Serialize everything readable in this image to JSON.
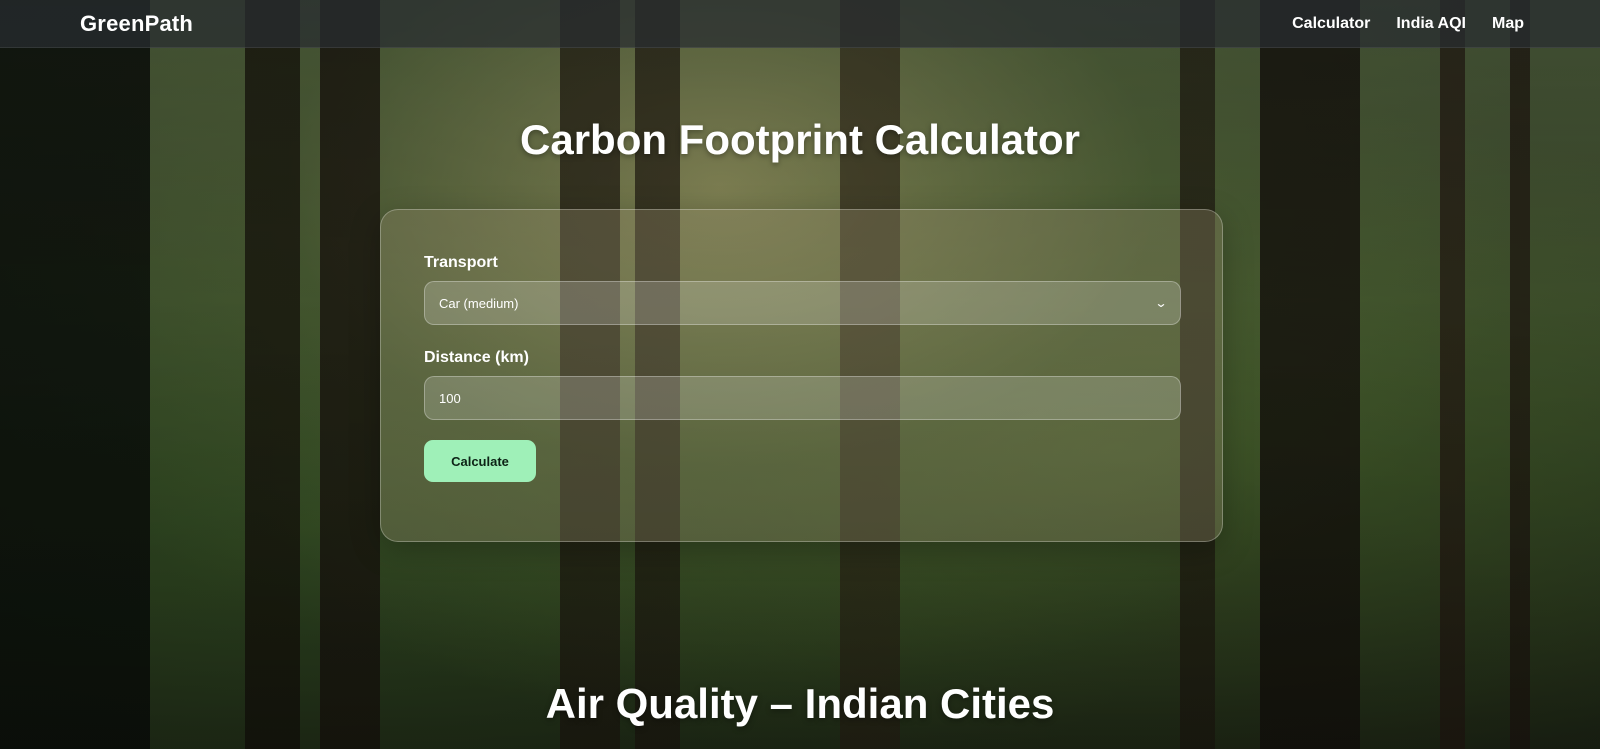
{
  "nav": {
    "brand": "GreenPath",
    "links": [
      "Calculator",
      "India AQI",
      "Map"
    ]
  },
  "calculator": {
    "title": "Carbon Footprint Calculator",
    "transport_label": "Transport",
    "transport_selected": "Car (medium)",
    "distance_label": "Distance (km)",
    "distance_value": "100",
    "calculate_label": "Calculate"
  },
  "aqi": {
    "title": "Air Quality – Indian Cities"
  },
  "icons": {
    "select_chevron": "chevron-down-icon"
  },
  "colors": {
    "accent_button": "#9ff0b8",
    "text": "#ffffff"
  }
}
